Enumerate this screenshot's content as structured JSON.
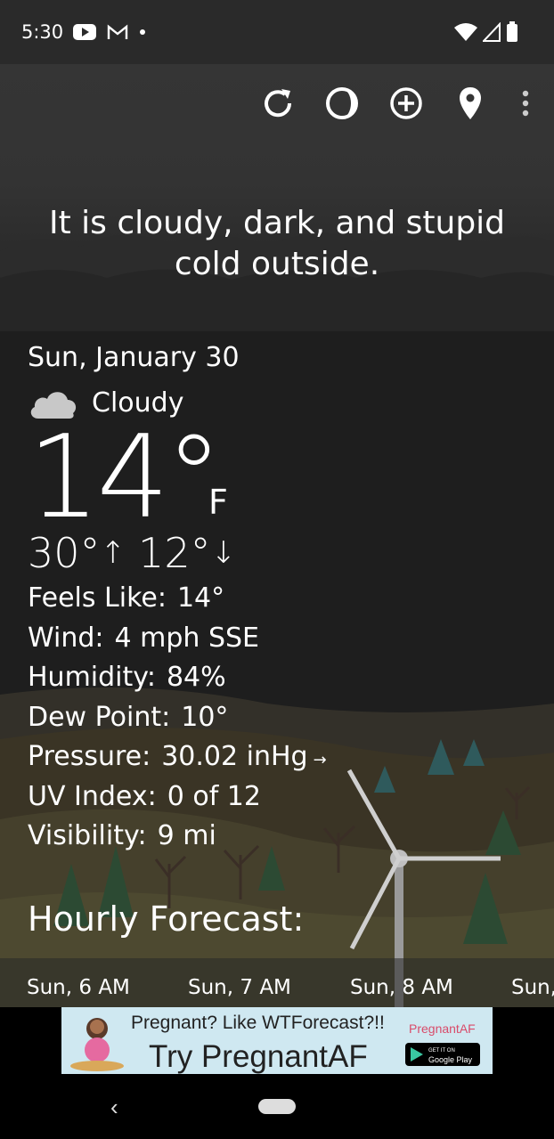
{
  "status_bar": {
    "time": "5:30",
    "left_icons": [
      "youtube-icon",
      "gmail-icon",
      "dot-icon"
    ],
    "right_icons": [
      "wifi-icon",
      "signal-icon",
      "battery-icon"
    ]
  },
  "toolbar": {
    "icons": [
      "refresh-icon",
      "theme-icon",
      "add-location-icon",
      "location-pin-icon",
      "more-vert-icon"
    ]
  },
  "headline": "It is cloudy, dark, and stupid cold outside.",
  "current": {
    "date": "Sun, January 30",
    "condition_icon": "cloud-icon",
    "condition": "Cloudy",
    "temp": "14°",
    "unit": "F",
    "high": "30°",
    "high_arrow": "↑",
    "low": "12°",
    "low_arrow": "↓"
  },
  "stats": [
    {
      "label": "Feels Like:",
      "value": "14°"
    },
    {
      "label": "Wind:",
      "value": "4 mph SSE"
    },
    {
      "label": "Humidity:",
      "value": "84%"
    },
    {
      "label": "Dew Point:",
      "value": "10°"
    },
    {
      "label": "Pressure:",
      "value": "30.02 inHg",
      "trend": "→"
    },
    {
      "label": "UV Index:",
      "value": "0 of 12"
    },
    {
      "label": "Visibility:",
      "value": "9 mi"
    }
  ],
  "hourly": {
    "title": "Hourly Forecast:",
    "items": [
      "Sun, 6 AM",
      "Sun, 7 AM",
      "Sun, 8 AM",
      "Sun,"
    ]
  },
  "ad": {
    "line1": "Pregnant? Like WTForecast?!!",
    "brand": "PregnantAF",
    "line2": "Try PregnantAF",
    "store_small": "GET IT ON",
    "store": "Google Play"
  },
  "colors": {
    "background": "#1e1e1e",
    "text": "#ffffff",
    "ad_background": "#cfe8f1",
    "ad_brand": "#d94b6a"
  }
}
